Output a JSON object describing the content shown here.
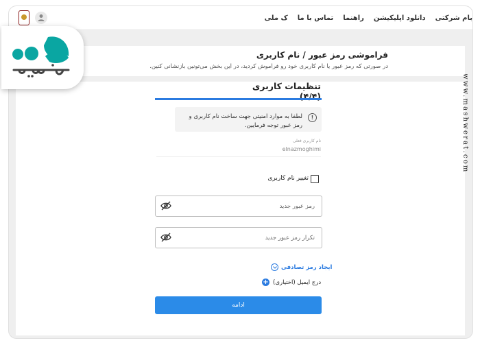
{
  "topnav": {
    "links": [
      "ک ملی",
      "تماس با ما",
      "راهنما",
      "دانلود اپلیکیشن",
      "بام شرکتی"
    ]
  },
  "logo": {
    "brand_text": "مشورت"
  },
  "header": {
    "title": "فراموشی رمز عبور / نام کاربری",
    "subtitle": "در صورتی که رمز عبور یا نام کاربری خود رو فراموش کردید، در این بخش می‌تونین بازنشانی کنین."
  },
  "form": {
    "step_title": "تنظیمات کاربری (۴/۴)",
    "notice": "لطفا به موارد امنیتی جهت ساخت نام کاربری و رمز عبور توجه فرمایین.",
    "username_label": "نام کاربری فعلی",
    "username_value": "elnazmoghimi",
    "change_username_label": "تغییر نام کاربری",
    "new_password_placeholder": "رمز عبور جدید",
    "repeat_password_placeholder": "تکرار رمز عبور جدید",
    "generate_password_label": "ایجاد رمز تصادفی",
    "add_email_label": "درج ایمیل (اختیاری)",
    "continue_label": "ادامه"
  },
  "watermark": {
    "text": "www.mashwerat.com"
  },
  "colors": {
    "accent": "#2b7be0",
    "button": "#2b8be8",
    "logo_teal": "#0aa6a2",
    "background": "#efefef"
  }
}
